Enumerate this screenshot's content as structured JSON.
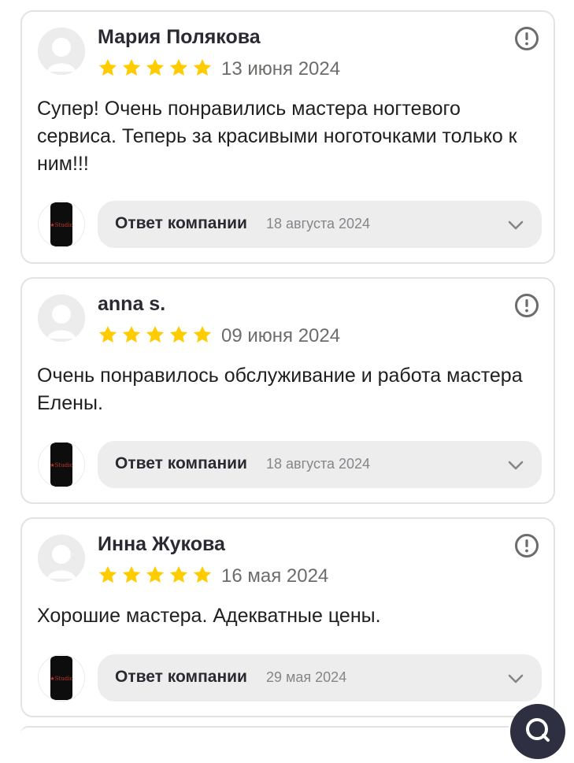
{
  "reviews": [
    {
      "author": "Мария Полякова",
      "rating": 5,
      "date": "13 июня 2024",
      "text": "Супер! Очень понравились мастера ногтевого сервиса. Теперь за красивыми ноготочками только к ним!!!",
      "reply": {
        "label": "Ответ компании",
        "date": "18 августа 2024"
      }
    },
    {
      "author": "anna s.",
      "rating": 5,
      "date": "09 июня 2024",
      "text": "Очень понравилось обслуживание и работа мастера Елены.",
      "reply": {
        "label": "Ответ компании",
        "date": "18 августа 2024"
      }
    },
    {
      "author": "Инна Жукова",
      "rating": 5,
      "date": "16 мая 2024",
      "text": "Хорошие мастера. Адекватные цены.",
      "reply": {
        "label": "Ответ компании",
        "date": "29 мая 2024"
      }
    }
  ],
  "icons": {
    "star": "star-icon",
    "report": "report-icon",
    "chevron": "chevron-down-icon",
    "avatar": "user-avatar-icon",
    "company": "company-logo-icon",
    "fab": "search-chat-icon"
  },
  "colors": {
    "star": "#ffcc00",
    "reply_background": "#ededed",
    "card_border": "#e3e3e3",
    "logo_text": "#c0392b"
  }
}
